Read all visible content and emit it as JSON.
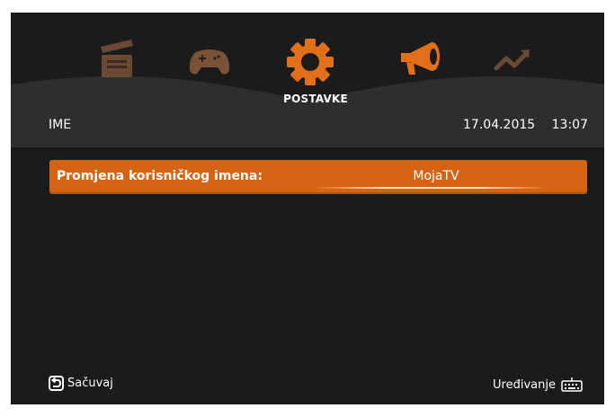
{
  "nav": {
    "items": [
      {
        "icon": "clapperboard-icon"
      },
      {
        "icon": "gamepad-icon"
      },
      {
        "icon": "gear-icon",
        "label": "POSTAVKE"
      },
      {
        "icon": "megaphone-icon"
      },
      {
        "icon": "trend-icon"
      }
    ]
  },
  "header": {
    "section_title": "IME",
    "date": "17.04.2015",
    "time": "13:07"
  },
  "form": {
    "field_label": "Promjena korisničkog imena:",
    "field_value": "MojaTV"
  },
  "footer": {
    "save_label": "Sačuvaj",
    "edit_label": "Uređivanje"
  },
  "colors": {
    "accent": "#d46413",
    "background": "#1b1b1b",
    "header_band": "#2e2e2e",
    "icon_dim": "#6b4a35"
  }
}
